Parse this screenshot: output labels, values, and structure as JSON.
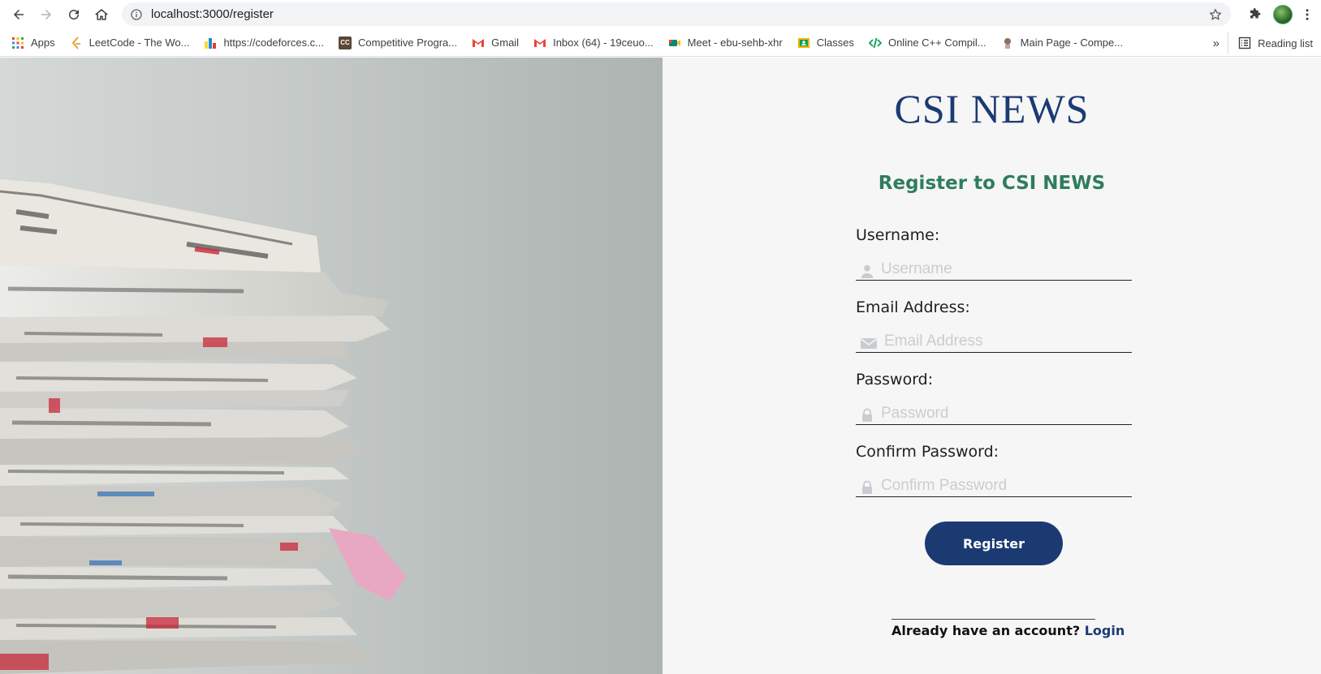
{
  "browser": {
    "url": "localhost:3000/register",
    "bookmarks": [
      {
        "label": "Apps",
        "icon": "apps-grid-icon",
        "color": "#ea4335"
      },
      {
        "label": "LeetCode - The Wo...",
        "icon": "leetcode-icon",
        "color": "#f89f1b"
      },
      {
        "label": "https://codeforces.c...",
        "icon": "codeforces-icon",
        "color": "#1f8acb"
      },
      {
        "label": "Competitive Progra...",
        "icon": "cc-icon",
        "color": "#5b4638"
      },
      {
        "label": "Gmail",
        "icon": "gmail-icon",
        "color": "#ea4335"
      },
      {
        "label": "Inbox (64) - 19ceuo...",
        "icon": "gmail-icon",
        "color": "#ea4335"
      },
      {
        "label": "Meet - ebu-sehb-xhr",
        "icon": "meet-icon",
        "color": "#00897b"
      },
      {
        "label": "Classes",
        "icon": "classroom-icon",
        "color": "#f4b400"
      },
      {
        "label": "Online C++ Compil...",
        "icon": "code-icon",
        "color": "#0f9d58"
      },
      {
        "label": "Main Page - Compe...",
        "icon": "wiki-icon",
        "color": "#8d6e63"
      }
    ],
    "more_label": "»",
    "reading_list": "Reading list"
  },
  "page": {
    "brand": "CSI NEWS",
    "heading": "Register to CSI NEWS",
    "fields": {
      "username": {
        "label": "Username:",
        "placeholder": "Username",
        "value": ""
      },
      "email": {
        "label": "Email Address:",
        "placeholder": "Email Address",
        "value": ""
      },
      "password": {
        "label": "Password:",
        "placeholder": "Password",
        "value": ""
      },
      "confirm": {
        "label": "Confirm Password:",
        "placeholder": "Confirm Password",
        "value": ""
      }
    },
    "register_label": "Register",
    "footer_text": "Already have an account?",
    "login_label": "Login",
    "colors": {
      "brand": "#1c3a72",
      "heading": "#2e7d5b",
      "button": "#1c3a72",
      "panel_bg": "#f6f6f6"
    }
  }
}
